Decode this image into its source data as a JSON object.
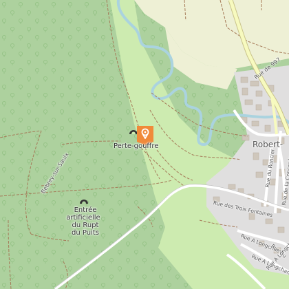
{
  "map": {
    "colors": {
      "forest": "#add19e",
      "meadow": "#cdebb0",
      "farmland": "#eef0d5",
      "residential": "#e0dfdf",
      "building": "#cfc7bc",
      "water": "#aad3df",
      "road_major": "#f7fabf",
      "marker": "#f08a3a"
    },
    "pois": {
      "perte_label": "Perte-gouffre",
      "entree_line1": "Entrée",
      "entree_line2": "artificielle",
      "entree_line3": "du Rupt",
      "entree_line4": "du Puits"
    },
    "places": {
      "town": "Robert-"
    },
    "streets": {
      "rue_d997": "Rue de 997",
      "bebrey": "Bebrey-sur-Saulx",
      "trois_fontaines": "Rue des Trois Fontaines",
      "roncier": "Rue du Roncier",
      "concorde": "Rue de la Concorde",
      "longchamp1": "Rue A Longchamp",
      "longchamp2": "Rue A Longchamp",
      "longchamp3": "Rue du",
      "longchamp4": "Rue A Longchamp"
    },
    "icons": {
      "marker": "location-pin-icon",
      "cave": "cave-icon"
    }
  }
}
